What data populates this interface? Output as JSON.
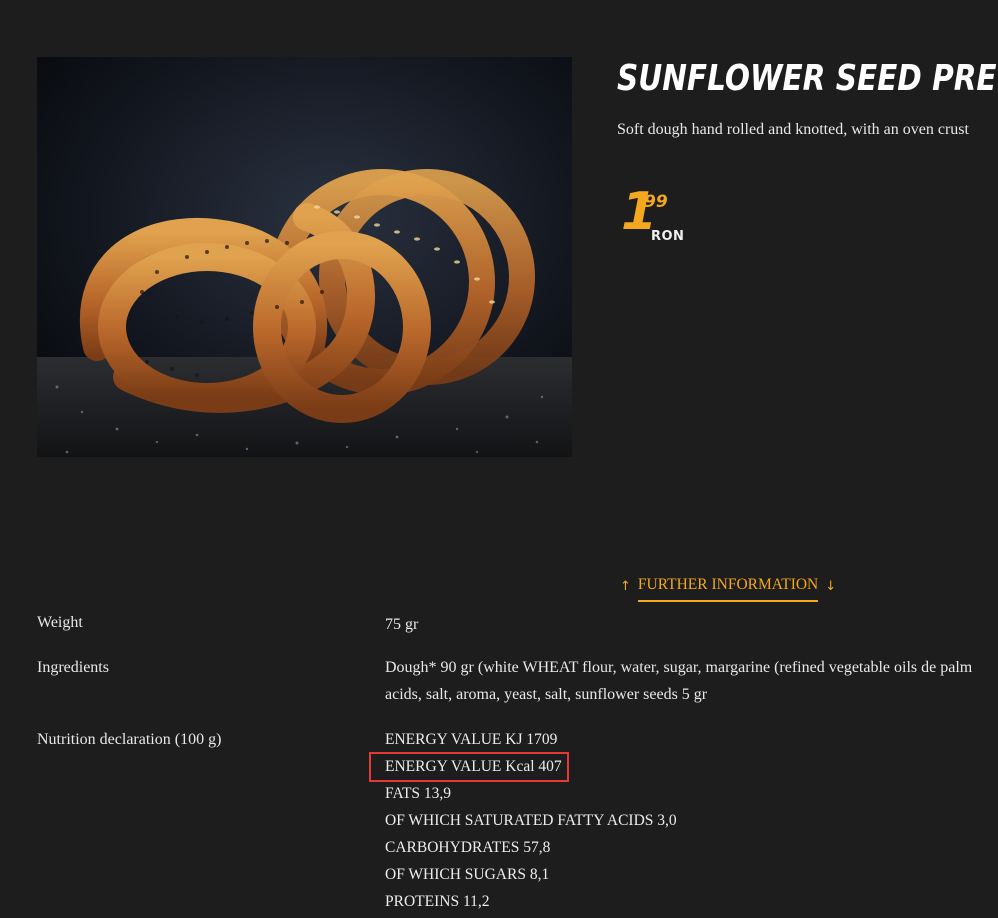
{
  "product": {
    "title": "SUNFLOWER SEED PRETZEL",
    "description": "Soft dough hand rolled and knotted, with an oven crust",
    "price": {
      "main": "1",
      "decimals": "99",
      "currency": "RON"
    },
    "image_alt_icon": "pretzel-photo"
  },
  "further_info": {
    "label": "FURTHER INFORMATION",
    "icon_left": "↑",
    "icon_right": "↓"
  },
  "specs": {
    "weight": {
      "label": "Weight",
      "value": "75 gr"
    },
    "ingredients": {
      "label": "Ingredients",
      "line1": "Dough* 90 gr (white WHEAT flour, water, sugar, margarine (refined vegetable oils de palm",
      "line2": "acids, salt, aroma, yeast, salt, sunflower seeds 5 gr"
    },
    "nutrition": {
      "label": "Nutrition declaration (100 g)",
      "lines": [
        "ENERGY VALUE KJ 1709",
        "ENERGY VALUE Kcal 407",
        "FATS 13,9",
        "OF WHICH SATURATED FATTY ACIDS 3,0",
        "CARBOHYDRATES 57,8",
        "OF WHICH SUGARS 8,1",
        "PROTEINS 11,2"
      ],
      "highlighted_index": 1
    }
  },
  "colors": {
    "background": "#1d1d1d",
    "accent": "#f3a81f",
    "highlight_border": "#e53935"
  }
}
